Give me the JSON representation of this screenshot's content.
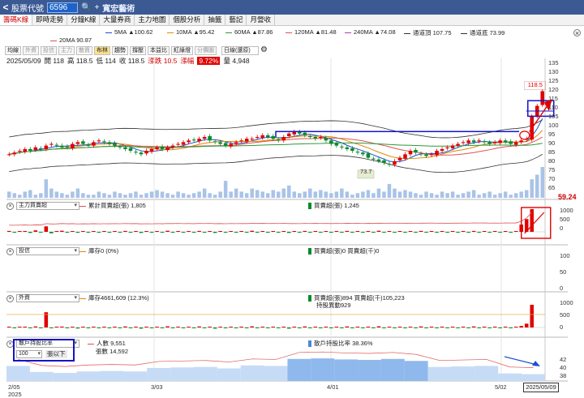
{
  "titlebar": {
    "back": "<",
    "label": "股票代號",
    "code": "6596",
    "search_icon": "search-icon",
    "add": "+",
    "stock_name": "寬宏藝術"
  },
  "tabs": [
    "籌碼K線",
    "即時走勢",
    "分鐘K線",
    "大量券商",
    "主力地圖",
    "個股分析",
    "抽籤",
    "藝記",
    "月營收"
  ],
  "ma_legend": [
    {
      "label": "5MA ▲100.62",
      "color": "#1a4fd6"
    },
    {
      "label": "10MA ▲95.42",
      "color": "#e08a00"
    },
    {
      "label": "60MA ▲87.86",
      "color": "#2a9a3a"
    },
    {
      "label": "120MA ▲81.48",
      "color": "#e05050"
    },
    {
      "label": "240MA ▲74.08",
      "color": "#b03ab0"
    },
    {
      "label": "通道頂 107.75",
      "color": "#333333"
    },
    {
      "label": "通道底 73.99",
      "color": "#333333"
    },
    {
      "label": "20MA 90.87",
      "color": "#e05050"
    }
  ],
  "toolbar_buttons": [
    "均線",
    "外資",
    "投信",
    "主力",
    "散資",
    "布林",
    "趨勢",
    "撐壓",
    "本益比",
    "紅綠燈",
    "分價圖"
  ],
  "period_select": "日線(還原)",
  "info": {
    "date": "2025/05/09",
    "open": "開 118",
    "high": "高 118.5",
    "low": "低 114",
    "close": "收 118.5",
    "change": "漲跌 10.5",
    "pct_label": "漲幅",
    "pct": "9.72%",
    "volume": "量 4,948"
  },
  "price_axis": [
    "135",
    "130",
    "125",
    "120",
    "115",
    "110",
    "105",
    "100",
    "95",
    "90",
    "85",
    "80",
    "75",
    "70",
    "65"
  ],
  "annotations": {
    "high_label": "118.5",
    "low_label": "73.7",
    "last_price": "59.24"
  },
  "panel_main_force": {
    "select": "主力買賣超",
    "legend1": "累計買賣超(張) 1,805",
    "legend2": "買賣超(張) 1,245",
    "axis": [
      "1000",
      "500",
      "0"
    ]
  },
  "panel_trust": {
    "select": "投信",
    "legend1": "庫存0 (0%)",
    "legend2": "買賣超(張)0 買賣超(千)0",
    "axis": [
      "100",
      "50",
      "0"
    ]
  },
  "panel_foreign": {
    "select": "外資",
    "legend1": "庫存4661,609 (12.3%)",
    "legend2": "買賣超(張)894 買賣超(千)105,223",
    "legend3": "持股異動929",
    "axis": [
      "1000",
      "500",
      "0"
    ]
  },
  "panel_holders": {
    "select": "散戶持股比率",
    "legend1": "人數 9,551",
    "legend2": "張數 14,592",
    "legend3": "散戶持股比率 38.36%",
    "threshold": "100",
    "threshold_label": "張以下",
    "axis": [
      "42",
      "40",
      "38"
    ]
  },
  "x_axis": {
    "labels": [
      "2/05",
      "3/03",
      "4/01",
      "5/02"
    ],
    "year": "2025",
    "cursor_date": "2025/05/09"
  },
  "colors": {
    "up": "#e00000",
    "down": "#0a8a2a",
    "accent": "#1d63c9",
    "highlight": "#1414c8"
  },
  "chart_data": {
    "type": "candlestick",
    "ylim": [
      62,
      137
    ],
    "close": [
      82,
      83,
      84,
      85,
      84,
      86,
      85,
      87,
      88,
      87,
      86,
      86,
      88,
      89,
      88,
      87,
      89,
      90,
      89,
      88,
      87,
      86,
      85,
      84,
      83,
      82,
      84,
      85,
      86,
      85,
      86,
      87,
      88,
      89,
      90,
      90,
      91,
      92,
      90,
      89,
      88,
      87,
      88,
      89,
      90,
      91,
      91,
      92,
      93,
      92,
      91,
      90,
      92,
      94,
      95,
      94,
      93,
      92,
      91,
      92,
      90,
      88,
      87,
      86,
      85,
      84,
      83,
      82,
      80,
      79,
      78,
      77,
      76,
      78,
      80,
      82,
      84,
      83,
      82,
      81,
      82,
      84,
      85,
      86,
      87,
      88,
      89,
      90,
      89,
      90,
      89,
      88,
      89,
      90,
      89,
      88,
      89,
      90,
      91,
      104,
      110,
      118.5
    ],
    "volume_rel": [
      0.2,
      0.15,
      0.1,
      0.2,
      0.25,
      0.1,
      0.15,
      0.6,
      0.3,
      0.2,
      0.15,
      0.1,
      0.2,
      0.3,
      0.15,
      0.1,
      0.1,
      0.2,
      0.15,
      0.1,
      0.2,
      0.15,
      0.1,
      0.15,
      0.2,
      0.1,
      0.15,
      0.2,
      0.25,
      0.2,
      0.15,
      0.1,
      0.2,
      0.15,
      0.1,
      0.15,
      0.2,
      0.3,
      0.15,
      0.1,
      0.2,
      0.55,
      0.2,
      0.3,
      0.2,
      0.15,
      0.3,
      0.25,
      0.2,
      0.15,
      0.25,
      0.2,
      0.3,
      0.4,
      0.2,
      0.15,
      0.2,
      0.3,
      0.2,
      0.25,
      0.2,
      0.15,
      0.2,
      0.3,
      0.2,
      0.1,
      0.15,
      0.2,
      0.25,
      0.15,
      0.3,
      0.2,
      0.45,
      0.3,
      0.2,
      0.25,
      0.2,
      0.15,
      0.1,
      0.2,
      0.15,
      0.1,
      0.2,
      0.15,
      0.2,
      0.1,
      0.15,
      0.2,
      0.25,
      0.1,
      0.15,
      0.2,
      0.1,
      0.15,
      0.2,
      0.1,
      0.15,
      0.2,
      0.25,
      0.6,
      0.75,
      1.0
    ],
    "main_force": [
      50,
      -30,
      20,
      40,
      -60,
      80,
      -20,
      300,
      -80,
      30,
      60,
      -40,
      20,
      -50,
      30,
      -20,
      40,
      -30,
      20,
      -10,
      30,
      -20,
      50,
      -40,
      20,
      -60,
      30,
      -20,
      40,
      -30,
      60,
      -20,
      30,
      -40,
      20,
      -30,
      50,
      -20,
      30,
      -60,
      20,
      -30,
      40,
      -20,
      30,
      -20,
      60,
      -30,
      20,
      -40,
      30,
      -20,
      40,
      -60,
      20,
      -30,
      50,
      -20,
      30,
      -40,
      20,
      -30,
      40,
      -20,
      50,
      -30,
      20,
      -40,
      30,
      -20,
      60,
      -30,
      40,
      -20,
      30,
      -40,
      20,
      -30,
      50,
      -20,
      30,
      -40,
      20,
      -30,
      40,
      -20,
      30,
      -20,
      50,
      -30,
      20,
      -40,
      30,
      -20,
      40,
      -30,
      20,
      400,
      700,
      1245
    ],
    "foreign": [
      20,
      -10,
      15,
      30,
      -20,
      40,
      -15,
      600,
      -30,
      20,
      35,
      -25,
      15,
      -40,
      20,
      -15,
      30,
      -20,
      15,
      -10,
      25,
      -15,
      40,
      -30,
      15,
      -45,
      20,
      -15,
      30,
      -20,
      45,
      -15,
      20,
      -30,
      15,
      -20,
      40,
      -15,
      25,
      -45,
      15,
      -20,
      30,
      -15,
      20,
      -15,
      45,
      -20,
      15,
      -30,
      20,
      -15,
      30,
      -45,
      15,
      -20,
      40,
      -15,
      20,
      -30,
      15,
      -20,
      30,
      -15,
      40,
      -20,
      15,
      -30,
      20,
      -15,
      45,
      -20,
      30,
      -15,
      20,
      -30,
      15,
      -20,
      40,
      -15,
      20,
      -30,
      15,
      -20,
      30,
      -15,
      20,
      -15,
      40,
      -20,
      15,
      -30,
      20,
      -15,
      30,
      -20,
      15,
      60,
      150,
      894
    ],
    "holder_ratio_weeks": [
      40.0,
      38.8,
      38.6,
      38.9,
      39.0,
      38.9,
      39.6,
      39.7,
      39.8,
      39.5,
      40.1,
      40.0,
      41.4,
      41.5,
      41.3,
      41.2,
      41.4,
      41.0,
      39.8,
      39.9,
      40.0,
      38.5,
      38.36
    ]
  }
}
